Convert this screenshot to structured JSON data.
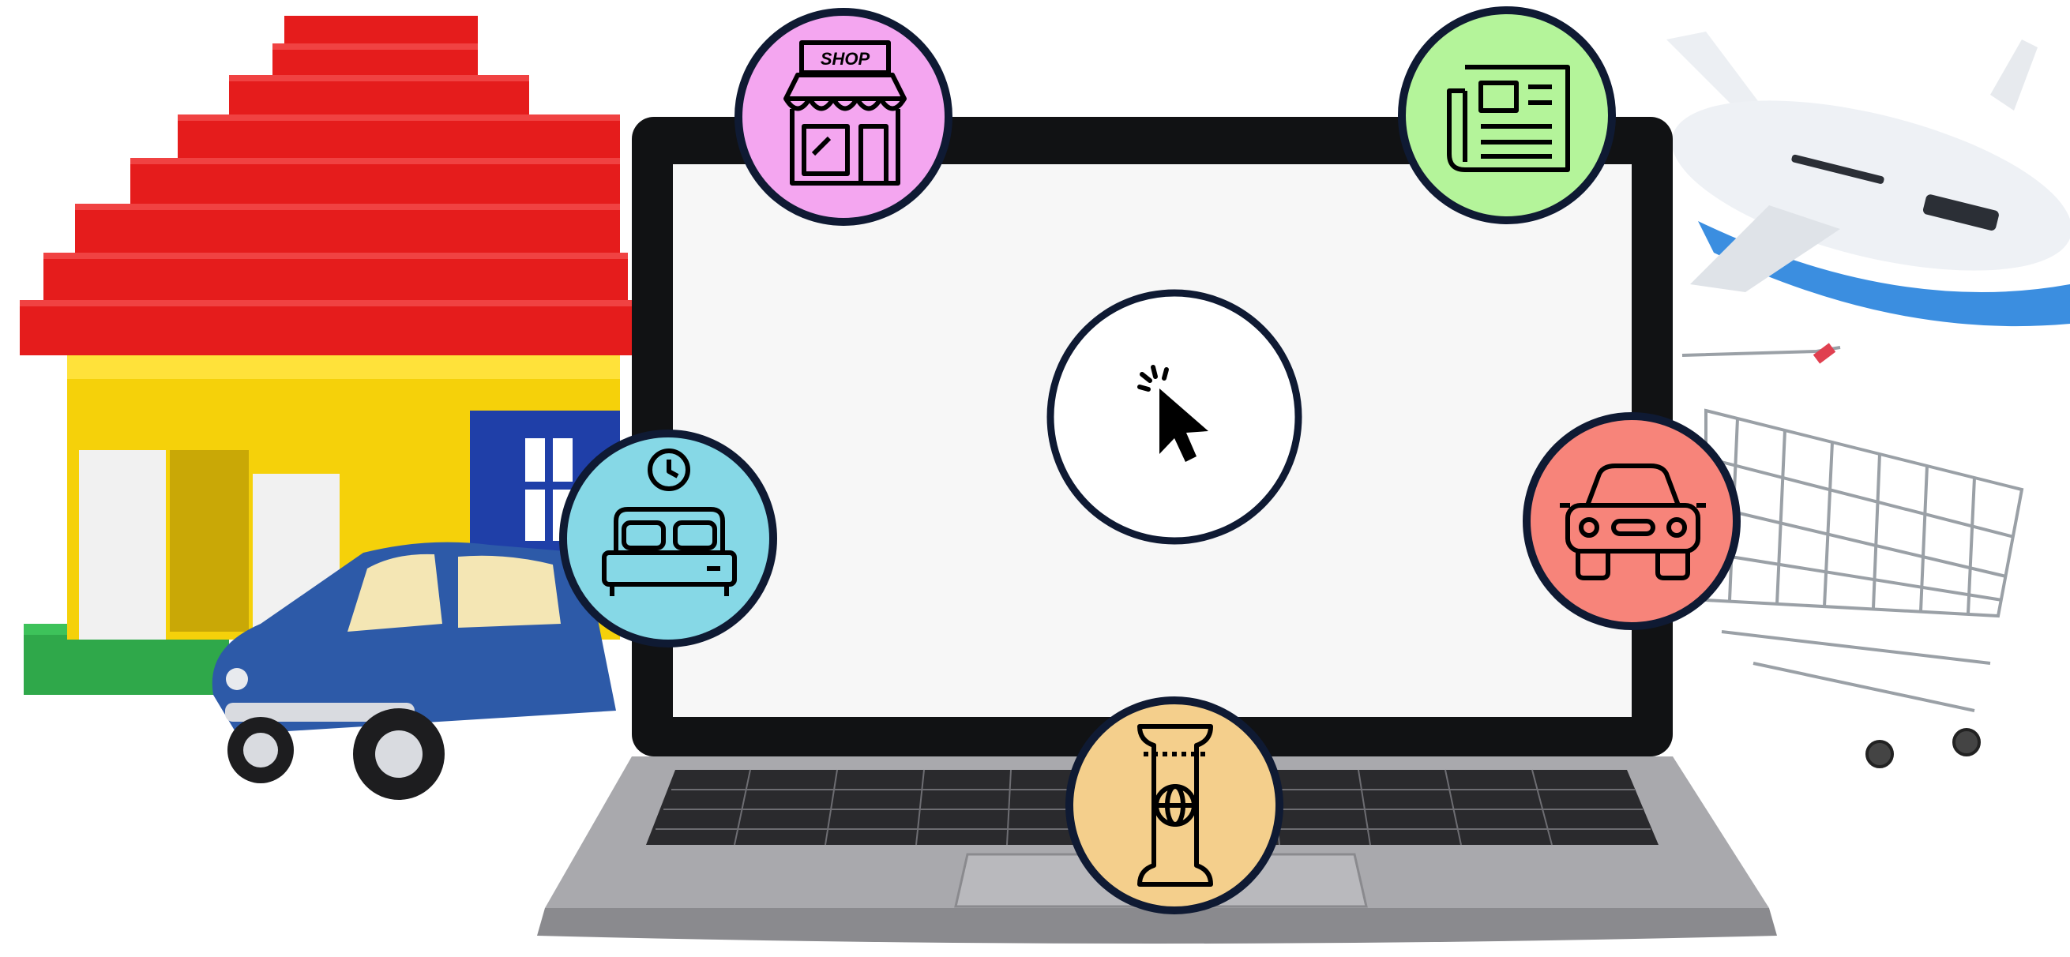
{
  "colors": {
    "outline": "#0f1a33",
    "shop_badge": "#f4a6f0",
    "news_badge": "#b4f49a",
    "hotel_badge": "#86d8e6",
    "car_rental_badge": "#f7847a",
    "ticket_badge": "#f4cf8c",
    "center_badge": "#ffffff",
    "screen": "#f7f7f7",
    "laptop_body": "#a9a9ad",
    "lego_red": "#e51c1c",
    "lego_yellow": "#f5d10a",
    "lego_blue": "#1f3fa8",
    "lego_green": "#2fa84a",
    "toy_car_blue": "#2d5aa8"
  },
  "icons": {
    "shop": "shop-storefront-icon",
    "news": "newspaper-icon",
    "hotel": "bed-clock-icon",
    "car_rental": "car-icon",
    "ticket": "travel-ticket-globe-icon",
    "click": "cursor-click-icon"
  },
  "shop_badge": {
    "sign_text": "SHOP"
  }
}
